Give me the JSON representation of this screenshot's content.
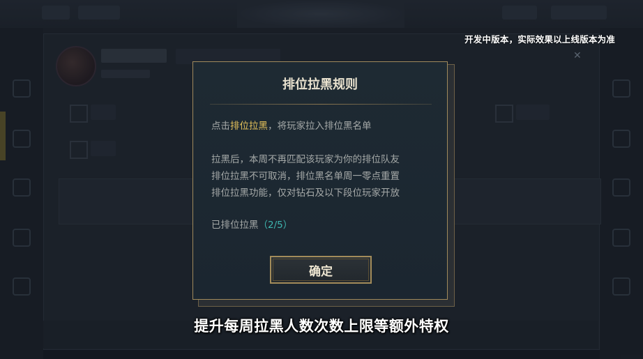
{
  "notice": {
    "dev_build": "开发中版本，实际效果以上线版本为准"
  },
  "modal": {
    "title": "排位拉黑规则",
    "line1_prefix": "点击",
    "line1_highlight": "排位拉黑",
    "line1_suffix": "，将玩家拉入排位黑名单",
    "rule1": "拉黑后，本周不再匹配该玩家为你的排位队友",
    "rule2": "排位拉黑不可取消，排位黑名单周一零点重置",
    "rule3": "排位拉黑功能，仅对钻石及以下段位玩家开放",
    "count_label": "已排位拉黑",
    "count_value": "（2/5）",
    "confirm_label": "确定"
  },
  "subtitle": {
    "text": "提升每周拉黑人数次数上限等额外特权"
  },
  "colors": {
    "highlight": "#e3c05a",
    "count": "#3fb6b0",
    "frame_gold": "#a08a5c"
  },
  "icons": {
    "close": "close-icon"
  }
}
